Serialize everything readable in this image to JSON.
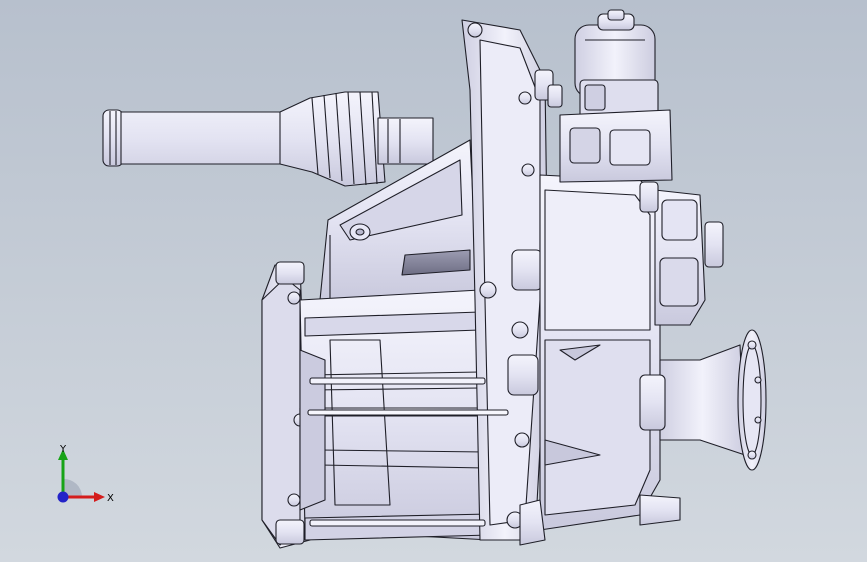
{
  "viewport": {
    "background_top": "#b7c0cd",
    "background_bottom": "#d2d8df",
    "part_fill": "#e9e9f7",
    "part_shadow": "#c3c3d8",
    "edge_color": "#1f1f28"
  },
  "triad": {
    "y_label": "Y",
    "x_label": "X",
    "y_color": "#17a317",
    "x_color": "#d41c1c",
    "z_color": "#2323c8",
    "icon": "coordinate-triad-icon"
  }
}
